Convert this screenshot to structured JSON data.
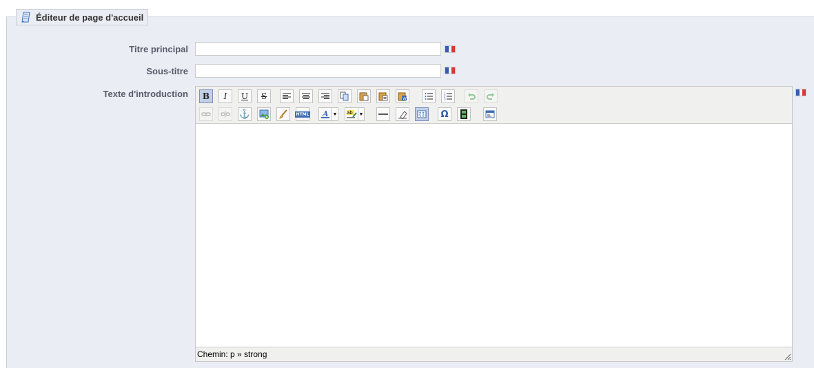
{
  "panel": {
    "title": "Éditeur de page d'accueil",
    "title_icon": "page-edit-icon"
  },
  "form": {
    "main_title": {
      "label": "Titre principal",
      "value": ""
    },
    "subtitle": {
      "label": "Sous-titre",
      "value": ""
    },
    "intro_text": {
      "label": "Texte d'introduction"
    }
  },
  "language_flag": {
    "icon": "french-flag-icon",
    "colors": [
      "#3a59b4",
      "#f4f4f4",
      "#d9363a"
    ]
  },
  "editor": {
    "toolbar_row1": [
      {
        "icon": "bold-icon",
        "glyph": "B",
        "active": true
      },
      {
        "icon": "italic-icon",
        "glyph": "I"
      },
      {
        "icon": "underline-icon",
        "glyph": "U"
      },
      {
        "icon": "strikethrough-icon",
        "glyph": "S"
      },
      {
        "icon": "align-left-icon"
      },
      {
        "icon": "align-center-icon"
      },
      {
        "icon": "align-right-icon"
      },
      {
        "icon": "copy-icon"
      },
      {
        "icon": "paste-icon"
      },
      {
        "icon": "paste-text-icon"
      },
      {
        "icon": "paste-word-icon"
      },
      {
        "icon": "bullet-list-icon"
      },
      {
        "icon": "numbered-list-icon"
      },
      {
        "icon": "undo-icon",
        "disabled": true
      },
      {
        "icon": "redo-icon",
        "disabled": true
      }
    ],
    "toolbar_row2": [
      {
        "icon": "link-icon",
        "disabled": true
      },
      {
        "icon": "unlink-icon",
        "disabled": true
      },
      {
        "icon": "anchor-icon"
      },
      {
        "icon": "insert-image-icon"
      },
      {
        "icon": "cleanup-icon"
      },
      {
        "icon": "html-source-icon"
      },
      {
        "icon": "text-color-icon"
      },
      {
        "icon": "highlight-color-icon"
      },
      {
        "icon": "horizontal-rule-icon"
      },
      {
        "icon": "remove-format-icon"
      },
      {
        "icon": "visual-aid-icon",
        "active": true
      },
      {
        "icon": "special-char-icon"
      },
      {
        "icon": "media-icon"
      },
      {
        "icon": "template-icon"
      }
    ],
    "html_label": "HTML",
    "highlight_label": "ab",
    "status_path": "Chemin: p » strong",
    "accent_color": "#3b5998"
  }
}
